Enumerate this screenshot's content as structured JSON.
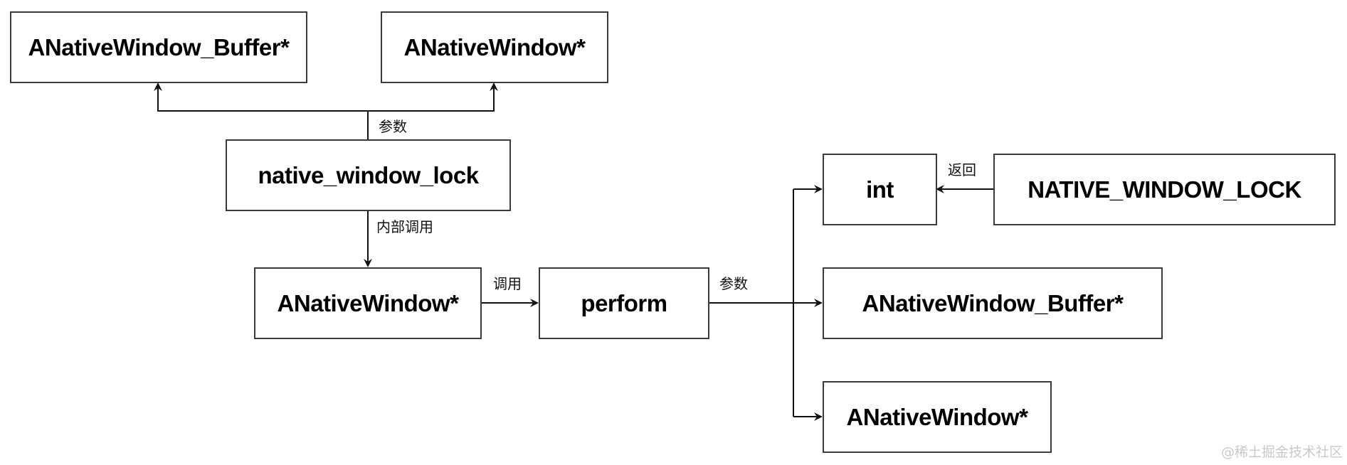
{
  "nodes": {
    "top_buffer": "ANativeWindow_Buffer*",
    "top_window": "ANativeWindow*",
    "native_window_lock": "native_window_lock",
    "mid_window": "ANativeWindow*",
    "perform": "perform",
    "int": "int",
    "native_window_lock_const": "NATIVE_WINDOW_LOCK",
    "right_buffer": "ANativeWindow_Buffer*",
    "right_window": "ANativeWindow*"
  },
  "edges": {
    "lock_params": "参数",
    "internal_call": "内部调用",
    "call": "调用",
    "perform_params": "参数",
    "return": "返回"
  },
  "watermark": "@稀土掘金技术社区"
}
